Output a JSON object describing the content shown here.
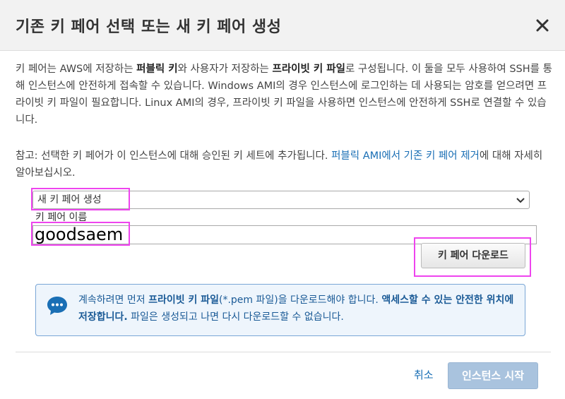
{
  "header": {
    "title": "기존 키 페어 선택 또는 새 키 페어 생성"
  },
  "intro": {
    "t1": "키 페어는 AWS에 저장하는 ",
    "b1": "퍼블릭 키",
    "t2": "와 사용자가 저장하는 ",
    "b2": "프라이빗 키 파일",
    "t3": "로 구성됩니다. 이 둘을 모두 사용하여 SSH를 통해 인스턴스에 안전하게 접속할 수 있습니다. Windows AMI의 경우 인스턴스에 로그인하는 데 사용되는 암호를 얻으려면 프라이빗 키 파일이 필요합니다. Linux AMI의 경우, 프라이빗 키 파일을 사용하면 인스턴스에 안전하게 SSH로 연결할 수 있습니다."
  },
  "note": {
    "text": "참고: 선택한 키 페어가 이 인스턴스에 대해 승인된 키 세트에 추가됩니다. ",
    "link": "퍼블릭 AMI에서 기존 키 페어 제거",
    "suffix": "에 대해 자세히 알아보십시오."
  },
  "form": {
    "select_value": "새 키 페어 생성",
    "name_label": "키 페어 이름",
    "name_value": "goodsaem",
    "download_label": "키 페어 다운로드"
  },
  "info": {
    "t1": "계속하려면 먼저 ",
    "b1": "프라이빗 키 파일",
    "t2": "(*.pem 파일)을 다운로드해야 합니다. ",
    "b2": "액세스할 수 있는 안전한 위치에 저장합니다.",
    "t3": " 파일은 생성되고 나면 다시 다운로드할 수 없습니다."
  },
  "footer": {
    "cancel_label": "취소",
    "launch_label": "인스턴스 시작"
  },
  "colors": {
    "accent": "#1a6fb5",
    "highlight": "#ee44ee",
    "launch_disabled": "#a9c3de",
    "info_bg": "#eef5fc"
  },
  "icons": {
    "close": "close-icon",
    "dropdown": "chevron-down-icon",
    "info": "chat-bubble-icon"
  }
}
